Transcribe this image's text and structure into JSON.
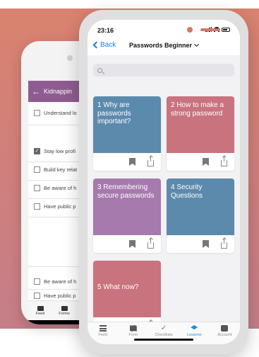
{
  "colors": {
    "background": "#d07f7d",
    "back_phone_header": "#8e5c90",
    "accent_blue": "#1a7cf2",
    "card_blue": "#5c8aad",
    "card_rose": "#c9737f",
    "card_purple": "#a67aad",
    "tab_active": "#1e8fd6"
  },
  "back_phone": {
    "header_title": "Kidnappin",
    "back_icon": "arrow-left-icon",
    "items": [
      {
        "label": "Understand lo",
        "checked": false
      },
      {
        "label": "Stay low profi",
        "checked": true
      },
      {
        "label": "Build key relat",
        "checked": false
      },
      {
        "label": "Be aware of h",
        "checked": false
      },
      {
        "label": "Have public p",
        "checked": false
      },
      {
        "label": "Be aware of h",
        "checked": false
      },
      {
        "label": "Have public p",
        "checked": false
      }
    ],
    "tabs": [
      {
        "label": "Feed",
        "icon": "feed-icon"
      },
      {
        "label": "Forms",
        "icon": "form-icon"
      }
    ],
    "nav_back_icon": "triangle-back-icon",
    "nav_back_glyph": "◁"
  },
  "status_bar": {
    "time": "23:16",
    "icons": [
      "signal-icon",
      "wifi-icon",
      "battery-icon"
    ]
  },
  "nav": {
    "back_label": "Back",
    "title": "Passwords Beginner"
  },
  "search": {
    "placeholder": "",
    "value": ""
  },
  "lessons": [
    {
      "title": "1 Why are passwords important?",
      "color": "#5c8aad"
    },
    {
      "title": "2 How to make a strong password",
      "color": "#c9737f"
    },
    {
      "title": "3 Remembering secure passwords",
      "color": "#a67aad"
    },
    {
      "title": "4 Security Questions",
      "color": "#5c8aad"
    },
    {
      "title": "5 What now?",
      "color": "#c9737f"
    }
  ],
  "tabs": [
    {
      "label": "Feed",
      "icon": "feed-icon"
    },
    {
      "label": "Form",
      "icon": "form-icon"
    },
    {
      "label": "Checklists",
      "icon": "checklist-icon"
    },
    {
      "label": "Lessons",
      "icon": "lessons-icon",
      "active": true
    },
    {
      "label": "Account",
      "icon": "account-icon"
    }
  ]
}
